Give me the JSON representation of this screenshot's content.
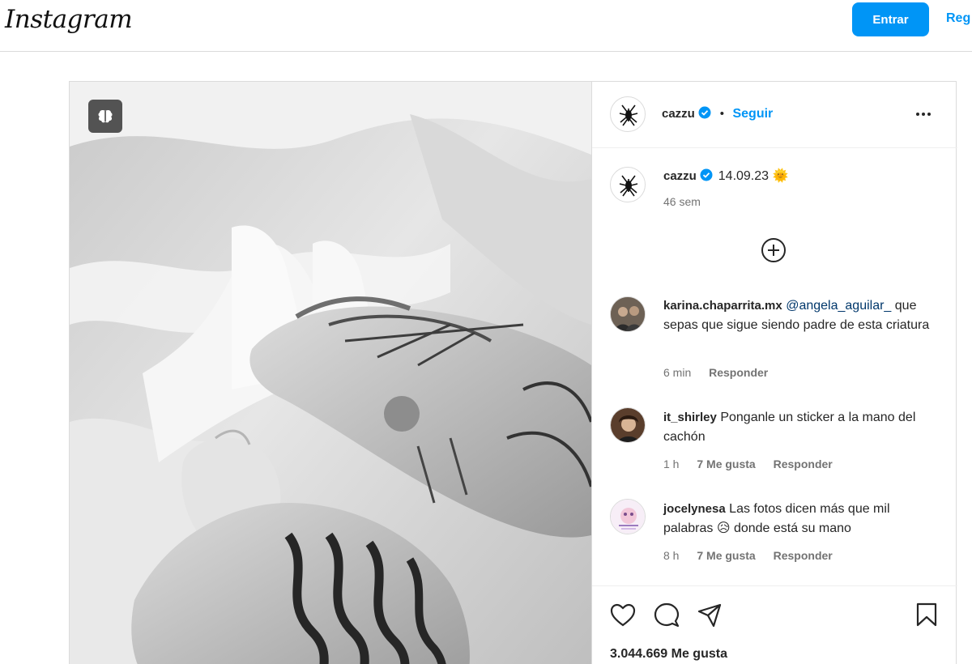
{
  "nav": {
    "logo": "Instagram",
    "login_label": "Entrar",
    "signup_label": "Reg"
  },
  "post": {
    "header": {
      "username": "cazzu",
      "separator": "•",
      "follow_label": "Seguir"
    },
    "caption": {
      "username": "cazzu",
      "text": "14.09.23",
      "emoji": "🌞",
      "time": "46 sem"
    },
    "comments": [
      {
        "username": "karina.chaparrita.mx",
        "mention": "@angela_aguilar_",
        "text": "que sepas que sigue siendo padre de esta criatura",
        "time": "6 min",
        "likes": "",
        "reply_label": "Responder"
      },
      {
        "username": "it_shirley",
        "mention": "",
        "text": "Ponganle un sticker a la mano del cachón",
        "time": "1 h",
        "likes": "7 Me gusta",
        "reply_label": "Responder"
      },
      {
        "username": "jocelynesa",
        "mention": "",
        "text": "Las fotos dicen más que mil palabras 😥 donde está su mano",
        "time": "8 h",
        "likes": "7 Me gusta",
        "reply_label": "Responder"
      }
    ],
    "likes_count": "3.044.669 Me gusta"
  },
  "icons": {
    "carousel_badge": "brain-icon",
    "more": "more-horizontal-icon",
    "load_more": "plus-circle-icon",
    "like": "heart-icon",
    "comment": "comment-icon",
    "share": "send-icon",
    "save": "bookmark-icon",
    "verified": "verified-badge-icon"
  },
  "colors": {
    "accent": "#0095f6",
    "verified": "#0095f6",
    "text": "#262626",
    "muted": "#737373",
    "border": "#dbdbdb"
  }
}
